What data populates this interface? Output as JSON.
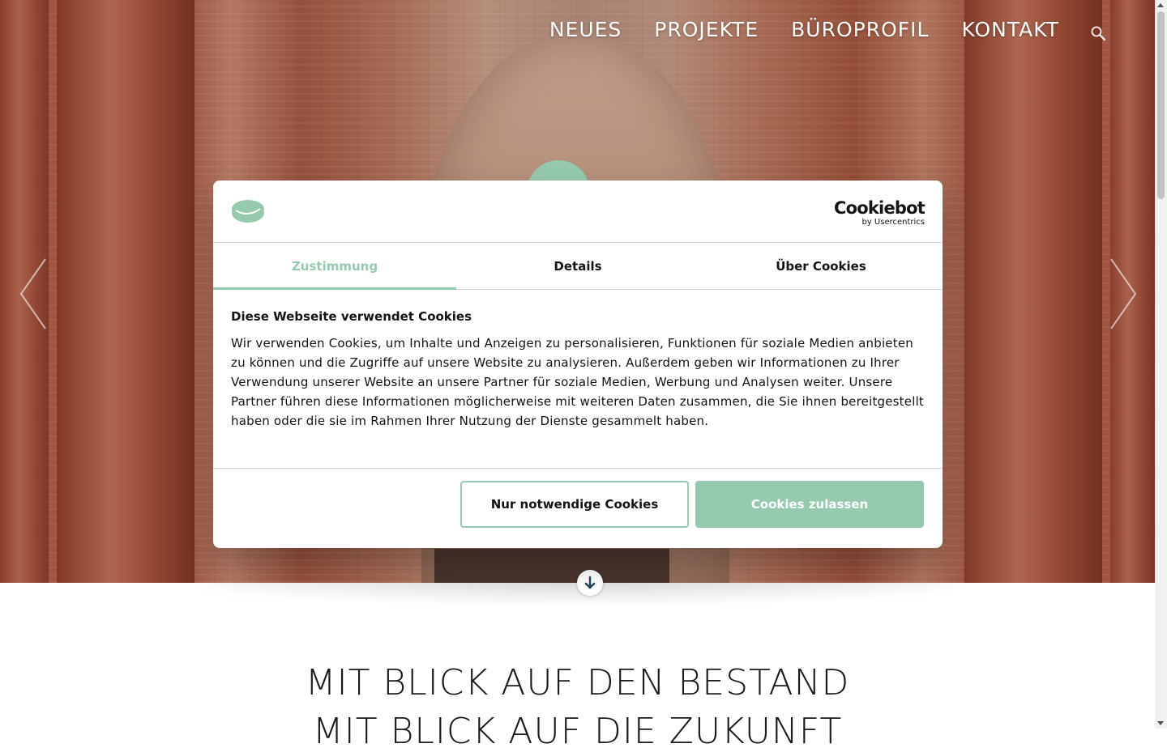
{
  "nav": {
    "items": [
      "NEUES",
      "PROJEKTE",
      "BÜROPROFIL",
      "KONTAKT"
    ],
    "search_icon": "search-icon"
  },
  "hero": {
    "headline_line1": "MIT BLICK AUF DEN BESTAND",
    "headline_line2": "MIT BLICK AUF DIE ZUKUNFT"
  },
  "cookie_dialog": {
    "brand_name": "Cookiebot",
    "brand_sub": "by Usercentrics",
    "tabs": [
      "Zustimmung",
      "Details",
      "Über Cookies"
    ],
    "active_tab": "Zustimmung",
    "title": "Diese Webseite verwendet Cookies",
    "text": "Wir verwenden Cookies, um Inhalte und Anzeigen zu personalisieren, Funktionen für soziale Medien anbieten zu können und die Zugriffe auf unsere Website zu analysieren. Außerdem geben wir Informationen zu Ihrer Verwendung unserer Website an unsere Partner für soziale Medien, Werbung und Analysen weiter. Unsere Partner führen diese Informationen möglicherweise mit weiteren Daten zusammen, die Sie ihnen bereitgestellt haben oder die sie im Rahmen Ihrer Nutzung der Dienste gesammelt haben.",
    "button_necessary": "Nur notwendige Cookies",
    "button_allow": "Cookies zulassen"
  },
  "colors": {
    "accent": "#95caae",
    "text": "#141414"
  }
}
